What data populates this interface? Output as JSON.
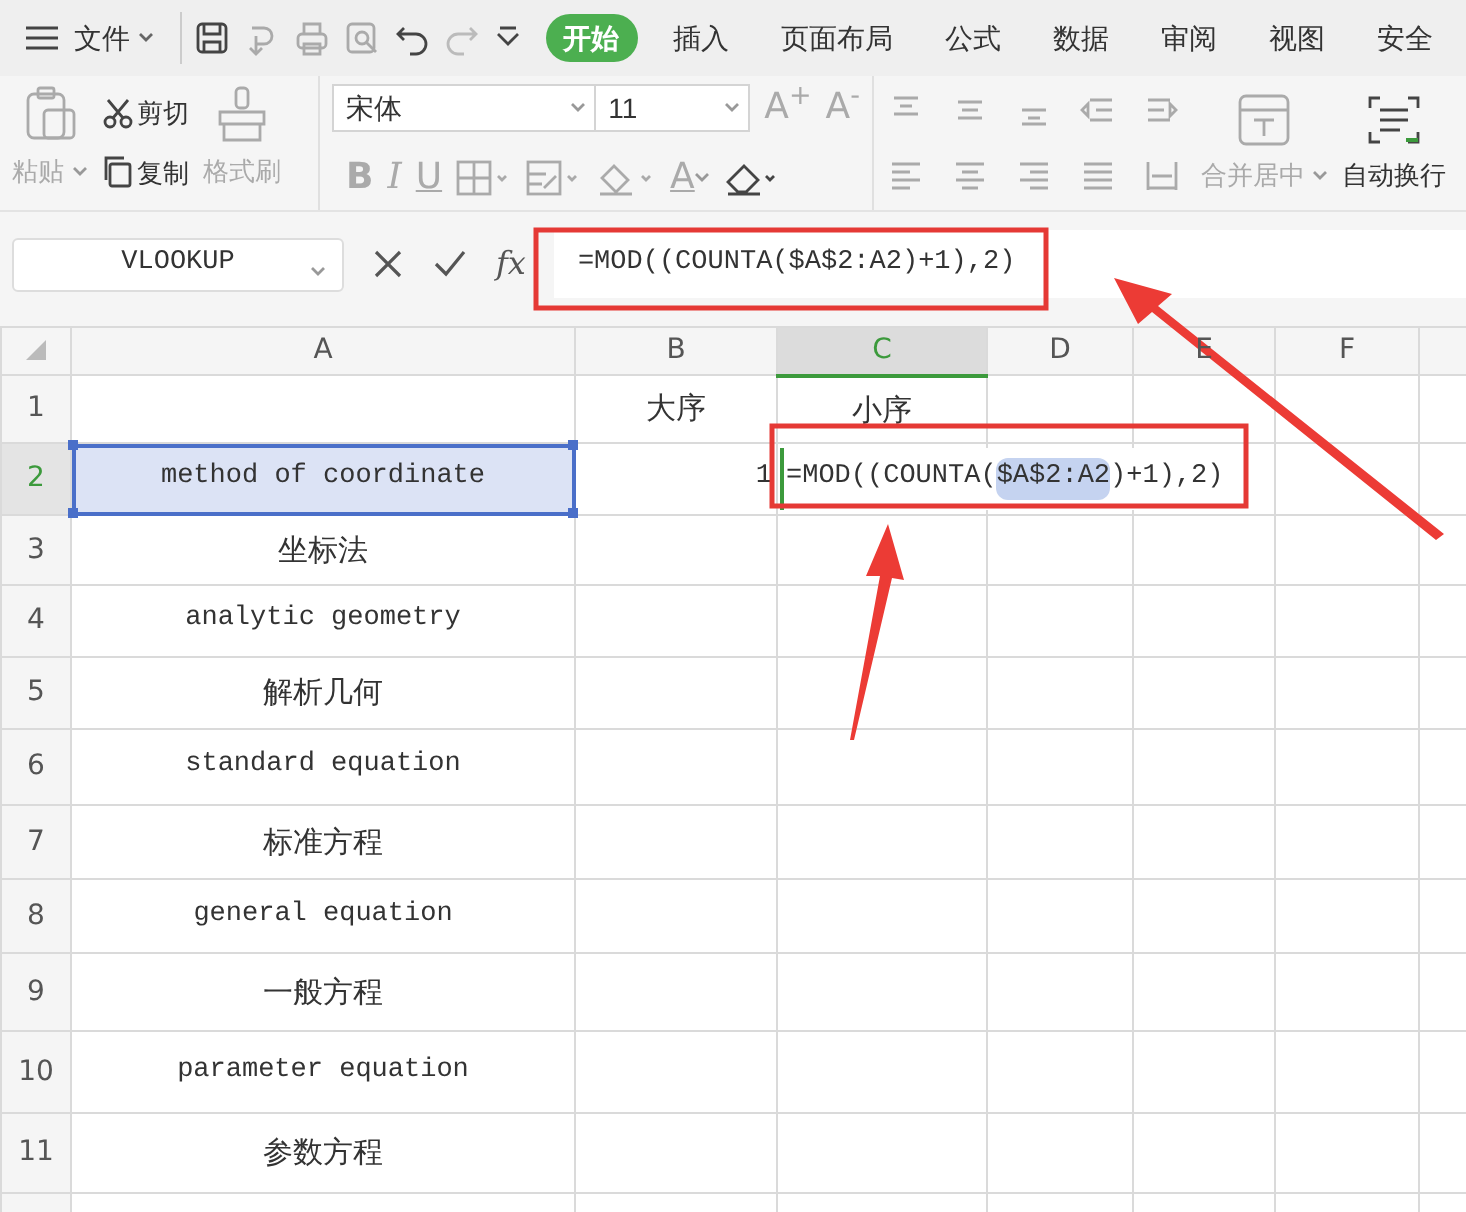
{
  "menu_bar": {
    "file_label": "文件",
    "tabs": [
      {
        "label": "开始",
        "selected": true
      },
      {
        "label": "插入",
        "selected": false
      },
      {
        "label": "页面布局",
        "selected": false
      },
      {
        "label": "公式",
        "selected": false
      },
      {
        "label": "数据",
        "selected": false
      },
      {
        "label": "审阅",
        "selected": false
      },
      {
        "label": "视图",
        "selected": false
      },
      {
        "label": "安全",
        "selected": false
      }
    ]
  },
  "ribbon": {
    "clipboard": {
      "paste": {
        "label": "粘贴",
        "disabled": true
      },
      "cut": {
        "label": "剪切",
        "disabled": false
      },
      "copy": {
        "label": "复制",
        "disabled": false
      },
      "format_painter": {
        "label": "格式刷",
        "disabled": true
      }
    },
    "font": {
      "name": "宋体",
      "size": "11",
      "grow": "A$^{+}$",
      "shrink": "A$^{-}$",
      "styles": [
        {
          "glyph": "B",
          "kind": "bold"
        },
        {
          "glyph": "I",
          "kind": "italic"
        },
        {
          "glyph": "U",
          "kind": "underline"
        }
      ],
      "font_color": "A"
    },
    "alignment": {
      "merge": {
        "label": "合并居中",
        "disabled": true
      },
      "wrap": {
        "label": "自动换行",
        "disabled": false
      }
    }
  },
  "formula_bar": {
    "name_box": "VLOOKUP",
    "fx": "fx",
    "formula": "=MOD((COUNTA($A$2:A2)+1),2)"
  },
  "sheet": {
    "columns": [
      {
        "label": "A",
        "selected": false
      },
      {
        "label": "B",
        "selected": false
      },
      {
        "label": "C",
        "selected": true
      },
      {
        "label": "D",
        "selected": false
      },
      {
        "label": "E",
        "selected": false
      },
      {
        "label": "F",
        "selected": false
      }
    ],
    "rows": [
      {
        "label": "1",
        "active": false,
        "cells": [
          "",
          {
            "kind": "text",
            "text": "大序",
            "selected": false
          },
          {
            "kind": "text",
            "text": "小序",
            "selected": false
          },
          "",
          "",
          ""
        ]
      },
      {
        "label": "2",
        "active": true,
        "cells": [
          {
            "kind": "text",
            "text": "method of coordinate",
            "selected": true
          },
          {
            "kind": "number",
            "text": "1",
            "selected": false
          },
          {
            "kind": "editor",
            "selected": false,
            "segments": [
              {
                "text": "=MOD((COUNTA(",
                "highlight": false
              },
              {
                "text": "$A$2:A2",
                "highlight": true
              },
              {
                "text": ")+1),2)",
                "highlight": false
              }
            ]
          },
          "",
          "",
          ""
        ]
      },
      {
        "label": "3",
        "active": false,
        "cells": [
          {
            "kind": "text",
            "text": "坐标法",
            "selected": false
          },
          "",
          "",
          "",
          "",
          ""
        ]
      },
      {
        "label": "4",
        "active": false,
        "cells": [
          {
            "kind": "text",
            "text": "analytic geometry",
            "selected": false
          },
          "",
          "",
          "",
          "",
          ""
        ]
      },
      {
        "label": "5",
        "active": false,
        "cells": [
          {
            "kind": "text",
            "text": "解析几何",
            "selected": false
          },
          "",
          "",
          "",
          "",
          ""
        ]
      },
      {
        "label": "6",
        "active": false,
        "cells": [
          {
            "kind": "text",
            "text": "standard equation",
            "selected": false
          },
          "",
          "",
          "",
          "",
          ""
        ]
      },
      {
        "label": "7",
        "active": false,
        "cells": [
          {
            "kind": "text",
            "text": "标准方程",
            "selected": false
          },
          "",
          "",
          "",
          "",
          ""
        ]
      },
      {
        "label": "8",
        "active": false,
        "cells": [
          {
            "kind": "text",
            "text": "general equation",
            "selected": false
          },
          "",
          "",
          "",
          "",
          ""
        ]
      },
      {
        "label": "9",
        "active": false,
        "cells": [
          {
            "kind": "text",
            "text": "一般方程",
            "selected": false
          },
          "",
          "",
          "",
          "",
          ""
        ]
      },
      {
        "label": "10",
        "active": false,
        "cells": [
          {
            "kind": "text",
            "text": "parameter  equation",
            "selected": false
          },
          "",
          "",
          "",
          "",
          ""
        ]
      },
      {
        "label": "11",
        "active": false,
        "cells": [
          {
            "kind": "text",
            "text": "参数方程",
            "selected": false
          },
          "",
          "",
          "",
          "",
          ""
        ]
      }
    ]
  }
}
